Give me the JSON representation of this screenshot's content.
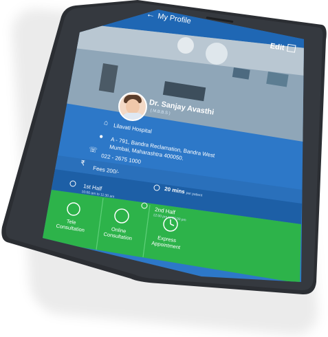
{
  "appbar": {
    "back_icon": "arrow-left-icon",
    "title": "My Profile"
  },
  "header": {
    "edit_label": "Edit",
    "edit_icon": "edit-icon"
  },
  "doctor": {
    "name": "Dr. Sanjay Avasthi",
    "degree": "( M.B.B.S )"
  },
  "details": {
    "hospital": "Lilavati Hospital",
    "address_line1": "A - 791, Bandra Reclamation, Bandra West",
    "address_line2": "Mumbai, Maharashtra 400050.",
    "phone": "022 - 2675 1000",
    "fees": "Fees 200/-"
  },
  "schedule": {
    "first_half": "1st Half",
    "first_time": "10:00 am to 11:30 am",
    "duration": "20 mins",
    "duration_suffix": "per patient",
    "second_half": "2nd Half",
    "second_time": "12:00 pm to 06:00 pm"
  },
  "actions": {
    "tele_line1": "Tele",
    "tele_line2": "Consultation",
    "online_line1": "Online",
    "online_line2": "Consultation",
    "express_line1": "Express",
    "express_line2": "Appointment"
  },
  "colors": {
    "blue": "#2d78c8",
    "blue_dark": "#1d5fa6",
    "green": "#2db34a",
    "phone_body": "#2b2e33"
  }
}
